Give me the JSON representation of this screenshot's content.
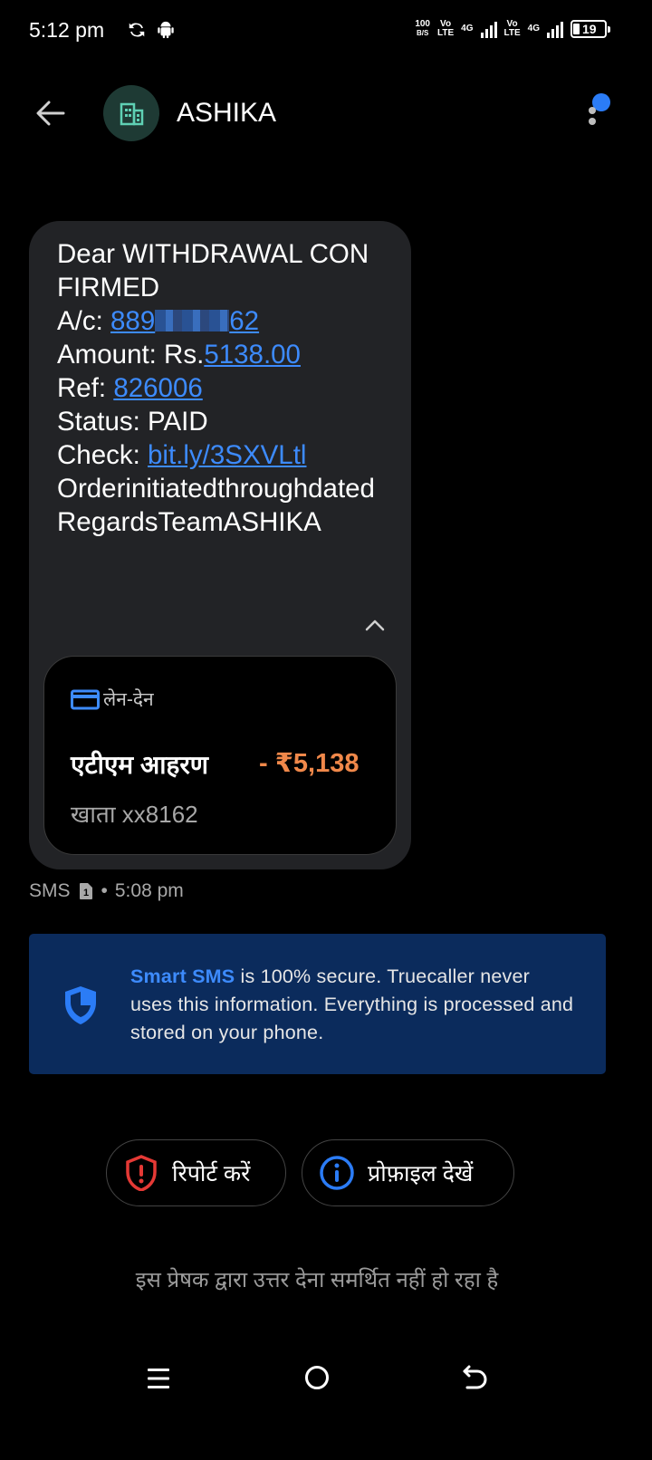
{
  "status_bar": {
    "time": "5:12 pm",
    "speed_value": "100",
    "speed_unit": "B/S",
    "sim1_top": "Vo",
    "sim1_bottom": "LTE",
    "sim1_net": "4G",
    "sim2_top": "Vo",
    "sim2_bottom": "LTE",
    "sim2_net": "4G",
    "battery": "19"
  },
  "header": {
    "sender": "ASHIKA",
    "avatar_icon": "building-icon"
  },
  "message": {
    "line1": "Dear WITHDRAWAL CONFIRMED",
    "account_label": "A/c: ",
    "account_prefix": "889",
    "account_suffix": "62",
    "amount_label": "Amount: Rs.",
    "amount_value": "5138.00",
    "ref_label": "Ref: ",
    "ref_value": "826006",
    "status_line": "Status: PAID",
    "check_label": "Check: ",
    "check_link": "bit.ly/3SXVLtl",
    "tail": "OrderinitiatedthroughdatedRegardsTeamASHIKA"
  },
  "transaction": {
    "tag": "लेन-देन",
    "title": "एटीएम आहरण",
    "amount": "- ₹5,138",
    "account": "खाता xx8162"
  },
  "meta": {
    "channel": "SMS",
    "sim": "1",
    "separator": "•",
    "time": "5:08 pm"
  },
  "banner": {
    "highlight": "Smart SMS",
    "text": " is 100% secure. Truecaller never uses this information. Everything is processed and stored on your phone."
  },
  "actions": {
    "report": "रिपोर्ट करें",
    "profile": "प्रोफ़ाइल देखें"
  },
  "footer_note": "इस प्रेषक द्वारा उत्तर देना समर्थित नहीं हो रहा है",
  "colors": {
    "link": "#3d8bfd",
    "amount": "#f0884a",
    "banner_bg": "#0b2b5c",
    "report_red": "#e53935"
  }
}
